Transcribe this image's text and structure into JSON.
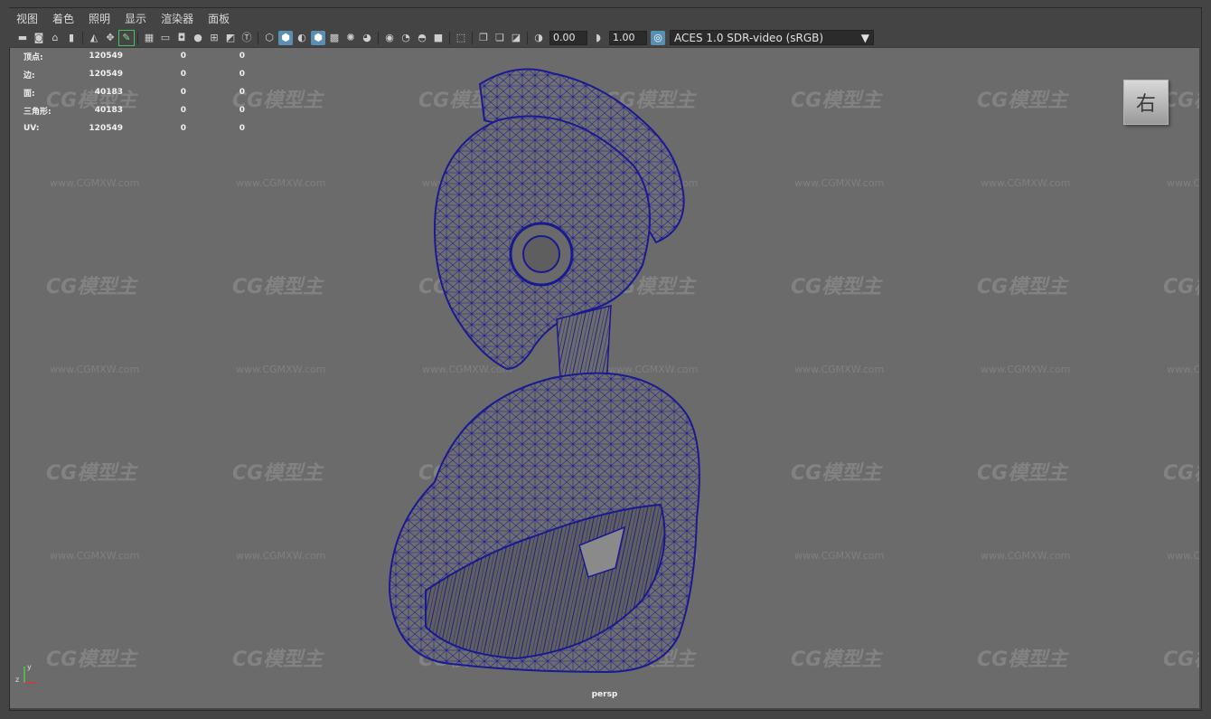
{
  "menu": [
    "视图",
    "着色",
    "照明",
    "显示",
    "渲染器",
    "面板"
  ],
  "toolbar": {
    "exposure_value": "0.00",
    "gamma_value": "1.00",
    "color_space": "ACES 1.0 SDR-video (sRGB)"
  },
  "hud": {
    "rows": [
      {
        "label": "顶点:",
        "v1": "120549",
        "v2": "0",
        "v3": "0"
      },
      {
        "label": "边:",
        "v1": "120549",
        "v2": "0",
        "v3": "0"
      },
      {
        "label": "面:",
        "v1": "40183",
        "v2": "0",
        "v3": "0"
      },
      {
        "label": "三角形:",
        "v1": "40183",
        "v2": "0",
        "v3": "0"
      },
      {
        "label": "UV:",
        "v1": "120549",
        "v2": "0",
        "v3": "0"
      }
    ]
  },
  "viewcube_label": "右",
  "camera_label": "persp",
  "axis": {
    "y": "y",
    "z": "z"
  },
  "watermark": {
    "logo": "CG模型主",
    "url": "www.CGMXW.com"
  },
  "colors": {
    "wire": "#1a1a9a",
    "mesh_fill": "#6e6e6e",
    "viewport": "#6b6b6b",
    "active_icon": "#5a8fb2"
  }
}
